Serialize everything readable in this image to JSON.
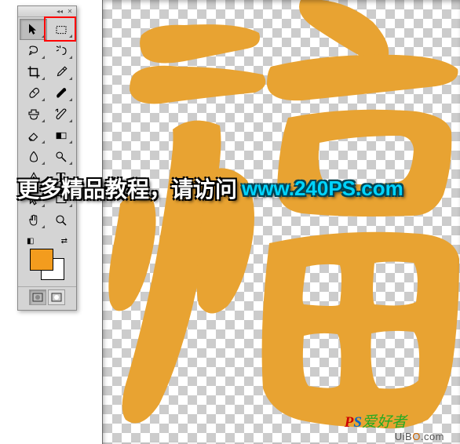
{
  "tools": {
    "move": "move-tool",
    "marquee": "rectangular-marquee-tool",
    "lasso": "lasso-tool",
    "wand": "magic-wand-tool",
    "crop": "crop-tool",
    "eyedropper": "eyedropper-tool",
    "healing": "spot-healing-brush-tool",
    "brush": "brush-tool",
    "stamp": "clone-stamp-tool",
    "history": "history-brush-tool",
    "eraser": "eraser-tool",
    "gradient": "gradient-tool",
    "blur": "blur-tool",
    "dodge": "dodge-tool",
    "pen": "pen-tool",
    "type": "type-tool",
    "path": "path-selection-tool",
    "shape": "rectangle-tool",
    "hand": "hand-tool",
    "zoom": "zoom-tool"
  },
  "colors": {
    "foreground": "#F39C1E",
    "background": "#FFFFFF"
  },
  "overlay": {
    "cn_text": "更多精品教程，请访问",
    "url": "www.240PS.com"
  },
  "watermarks": {
    "ps_prefix_p": "P",
    "ps_prefix_s": "S",
    "ps_text": "爱好者",
    "bottom_text": "UiB",
    "bottom_o": "O",
    "bottom_suffix": ".com"
  },
  "type_label": "T"
}
